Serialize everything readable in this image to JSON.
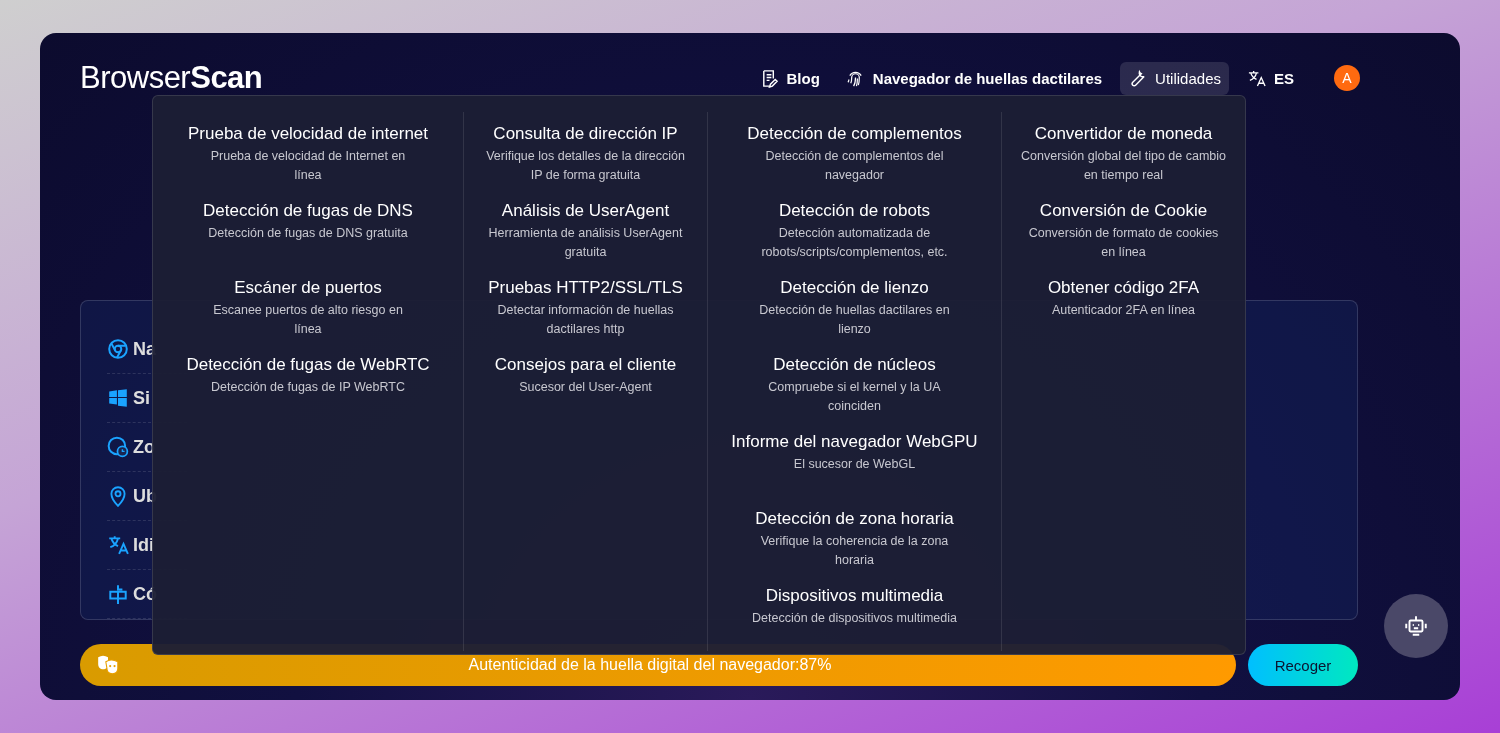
{
  "logo": {
    "light": "Browser",
    "bold": "Scan"
  },
  "nav": [
    {
      "kind": "blog",
      "label": "Blog",
      "selected": false
    },
    {
      "kind": "fingerprint",
      "label": "Navegador de huellas dactilares",
      "selected": false
    },
    {
      "kind": "tools",
      "label": "Utilidades",
      "selected": true
    },
    {
      "kind": "language",
      "label": "ES",
      "selected": false
    }
  ],
  "avatar": "A",
  "info_rows": [
    {
      "kind": "browser",
      "label": "Na"
    },
    {
      "kind": "os",
      "label": "Si"
    },
    {
      "kind": "timezone",
      "label": "Zo"
    },
    {
      "kind": "location",
      "label": "Ub"
    },
    {
      "kind": "language",
      "label": "Idi"
    },
    {
      "kind": "postal",
      "label": "Có"
    }
  ],
  "menu_columns": [
    [
      {
        "title": "Prueba de velocidad de internet",
        "description": "Prueba de velocidad de Internet en línea"
      },
      {
        "title": "Detección de fugas de DNS",
        "description": "Detección de fugas de DNS gratuita"
      },
      {
        "title": "Escáner de puertos",
        "description": "Escanee puertos de alto riesgo en línea"
      },
      {
        "title": "Detección de fugas de WebRTC",
        "description": "Detección de fugas de IP WebRTC"
      }
    ],
    [
      {
        "title": "Consulta de dirección IP",
        "description": "Verifique los detalles de la dirección IP de forma gratuita"
      },
      {
        "title": "Análisis de UserAgent",
        "description": "Herramienta de análisis UserAgent gratuita"
      },
      {
        "title": "Pruebas HTTP2/SSL/TLS",
        "description": "Detectar información de huellas dactilares http"
      },
      {
        "title": "Consejos para el cliente",
        "description": "Sucesor del User-Agent"
      }
    ],
    [
      {
        "title": "Detección de complementos",
        "description": "Detección de complementos del navegador"
      },
      {
        "title": "Detección de robots",
        "description": "Detección automatizada de robots/scripts/complementos, etc."
      },
      {
        "title": "Detección de lienzo",
        "description": "Detección de huellas dactilares en lienzo"
      },
      {
        "title": "Detección de núcleos",
        "description": "Compruebe si el kernel y la UA coinciden"
      },
      {
        "title": "Informe del navegador WebGPU",
        "description": "El sucesor de WebGL"
      },
      {
        "title": "Detección de zona horaria",
        "description": "Verifique la coherencia de la zona horaria"
      },
      {
        "title": "Dispositivos multimedia",
        "description": "Detección de dispositivos multimedia"
      }
    ],
    [
      {
        "title": "Convertidor de moneda",
        "description": "Conversión global del tipo de cambio en tiempo real"
      },
      {
        "title": "Conversión de Cookie",
        "description": "Conversión de formato de cookies en línea"
      },
      {
        "title": "Obtener código 2FA",
        "description": "Autenticador 2FA en línea"
      }
    ]
  ],
  "authenticity": "Autenticidad de la huella digital del navegador:87%",
  "collect_button": "Recoger"
}
